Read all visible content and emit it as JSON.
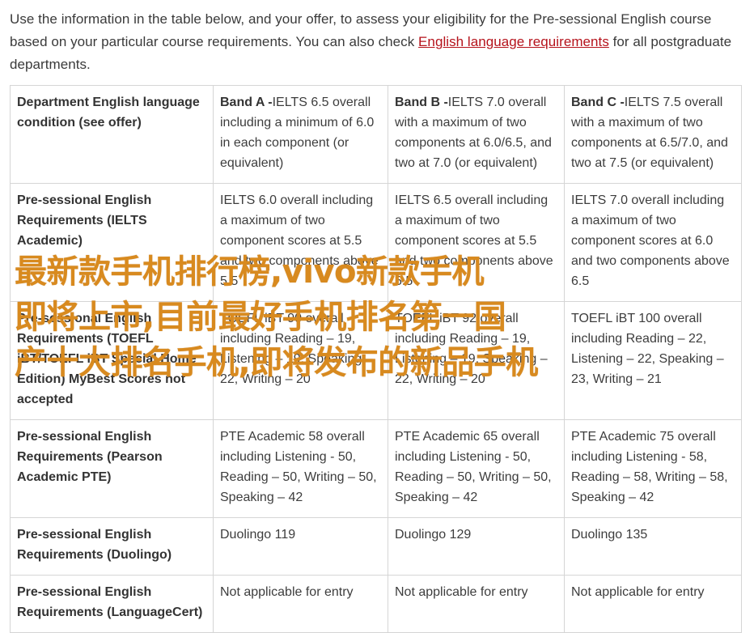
{
  "intro": {
    "text_before_link": "Use the information in the table below, and your offer, to assess your eligibility for the Pre-sessional English course based on your particular course requirements. You can also check ",
    "link_text": "English language requirements",
    "text_after_link": " for all postgraduate departments."
  },
  "table": {
    "header": {
      "col0": "Department English language condition (see offer)",
      "bands": [
        {
          "label": "Band A -",
          "text": "IELTS 6.5 overall including a minimum of 6.0 in each component (or equivalent)"
        },
        {
          "label": "Band B -",
          "text": "IELTS 7.0 overall with a maximum of two components at 6.0/6.5, and two at 7.0 (or equivalent)"
        },
        {
          "label": "Band C -",
          "text": "IELTS 7.5 overall with a maximum of two components at 6.5/7.0, and two at 7.5 (or equivalent)"
        }
      ]
    },
    "rows": [
      {
        "label": "Pre-sessional English Requirements (IELTS Academic)",
        "cells": [
          "IELTS 6.0 overall including a maximum of two component scores at 5.5 and two components above 5.5",
          "IELTS 6.5 overall including a maximum of two component scores at 5.5 and two components above 5.5",
          "IELTS 7.0 overall including a maximum of two component scores at 6.0 and two components above 6.5"
        ]
      },
      {
        "label": "Pre-sessional English Requirements (TOEFL iBT/TOEFL iBT Special Home Edition) MyBest Scores not accepted",
        "cells": [
          "TOEFL iBT 90 overall including Reading – 19, Listening – 19, Speaking – 22, Writing – 20",
          "TOEFL iBT 92 overall including Reading – 19, Listening – 19, Speaking – 22, Writing – 20",
          "TOEFL iBT 100 overall including Reading – 22, Listening – 22, Speaking – 23, Writing – 21"
        ]
      },
      {
        "label": "Pre-sessional English Requirements (Pearson Academic PTE)",
        "cells": [
          "PTE Academic 58 overall including Listening - 50, Reading – 50, Writing – 50, Speaking – 42",
          "PTE Academic 65 overall including Listening - 50, Reading – 50, Writing – 50, Speaking – 42",
          "PTE Academic 75 overall including Listening - 58, Reading – 58, Writing – 58, Speaking – 42"
        ]
      },
      {
        "label": "Pre-sessional English Requirements (Duolingo)",
        "cells": [
          "Duolingo 119",
          "Duolingo 129",
          "Duolingo 135"
        ]
      },
      {
        "label": "Pre-sessional English Requirements (LanguageCert)",
        "cells": [
          "Not applicable for entry",
          "Not applicable for entry",
          "Not applicable for entry"
        ]
      }
    ]
  },
  "overlay": {
    "lines": [
      "最新款手机排行榜,vivo新款手机",
      "即将上市,目前最好手机排名第一国",
      "产十大排名手机,即将发布的新品手机"
    ]
  },
  "colors": {
    "link": "#b5121b",
    "overlay_text": "#d88a1f",
    "table_border": "#d5d5d5"
  }
}
